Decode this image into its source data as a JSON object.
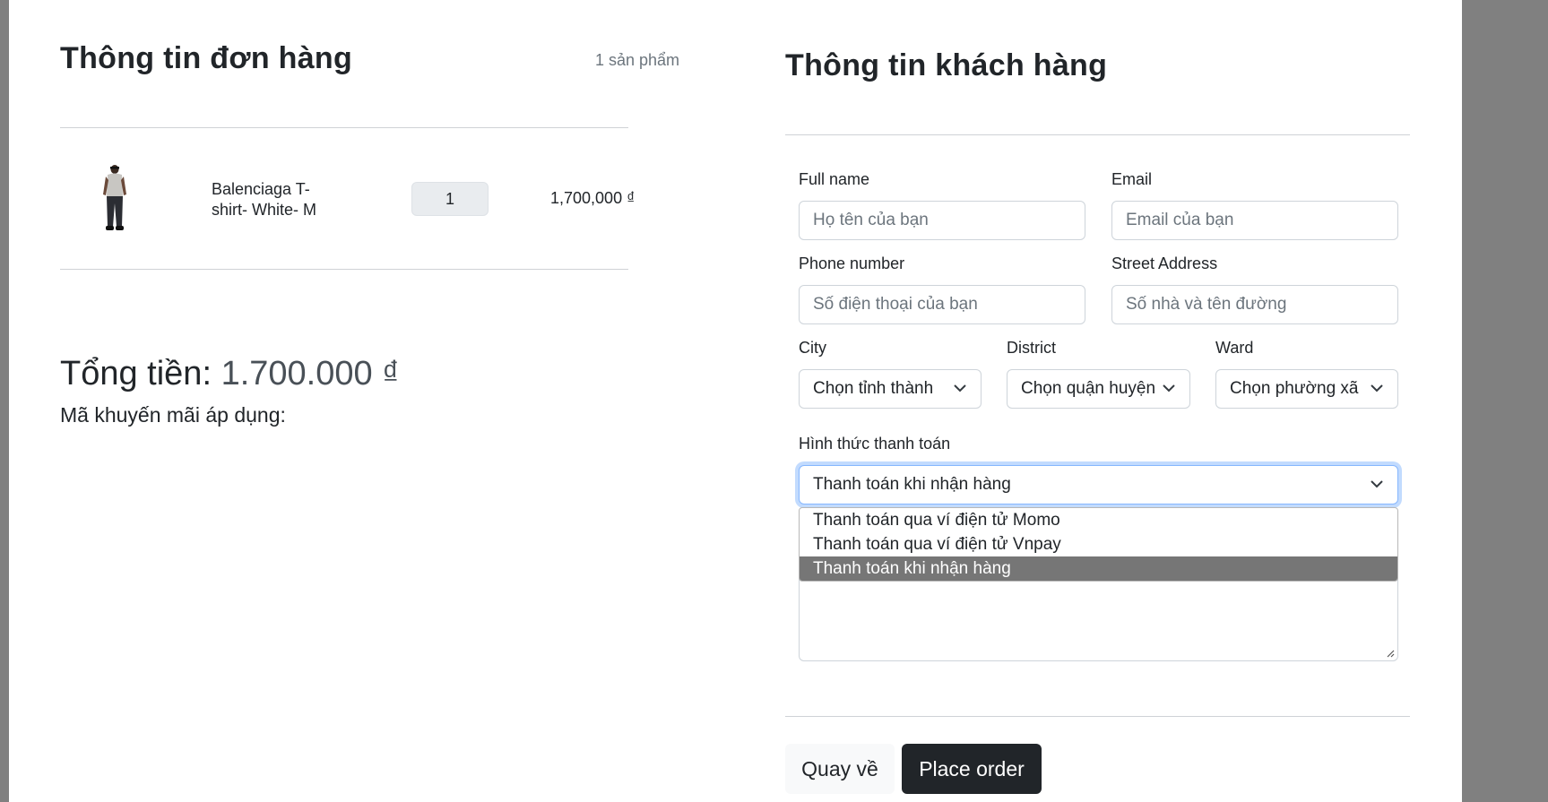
{
  "order": {
    "title": "Thông tin đơn hàng",
    "item_count": "1 sản phẩm",
    "items": [
      {
        "name": "Balenciaga T-shirt- White- M",
        "quantity": "1",
        "price": "1,700,000 ₫"
      }
    ],
    "total_label": "Tổng tiền:",
    "total_value": "1.700.000 ₫",
    "promo_label": "Mã khuyến mãi áp dụng:"
  },
  "customer": {
    "title": "Thông tin khách hàng",
    "full_name": {
      "label": "Full name",
      "placeholder": "Họ tên của bạn"
    },
    "email": {
      "label": "Email",
      "placeholder": "Email của bạn"
    },
    "phone": {
      "label": "Phone number",
      "placeholder": "Số điện thoại của bạn"
    },
    "street": {
      "label": "Street Address",
      "placeholder": "Số nhà và tên đường"
    },
    "city": {
      "label": "City",
      "value": "Chọn tỉnh thành"
    },
    "district": {
      "label": "District",
      "value": "Chọn quận huyện"
    },
    "ward": {
      "label": "Ward",
      "value": "Chọn phường xã"
    },
    "payment": {
      "label": "Hình thức thanh toán",
      "value": "Thanh toán khi nhận hàng",
      "options": [
        "Thanh toán qua ví điện tử Momo",
        "Thanh toán qua ví điện tử Vnpay",
        "Thanh toán khi nhận hàng"
      ],
      "selected_index": 2
    }
  },
  "actions": {
    "back_label": "Quay về",
    "order_label": "Place order"
  },
  "colors": {
    "backdrop": "#808080",
    "primary_button": "#212529",
    "selected_option": "#767676",
    "focus_ring": "#86b7fe"
  }
}
